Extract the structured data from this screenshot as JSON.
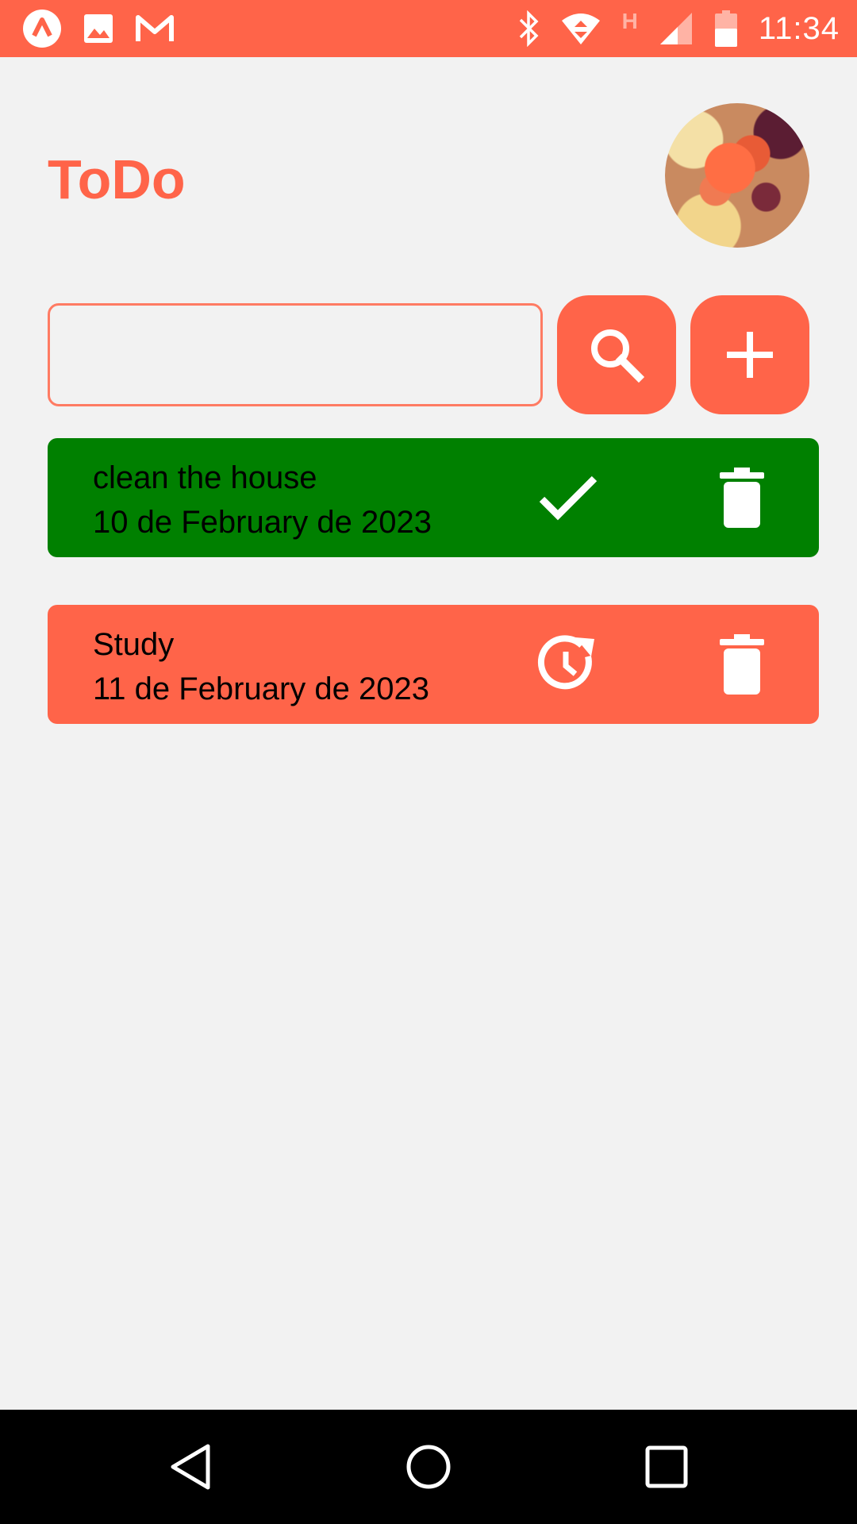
{
  "status_bar": {
    "time": "11:34",
    "left_icons": [
      "app-a-icon",
      "image-icon",
      "gmail-icon"
    ],
    "right_icons": [
      "bluetooth-icon",
      "wifi-icon",
      "h-network-icon",
      "signal-icon",
      "battery-icon"
    ],
    "network_label": "H"
  },
  "header": {
    "title": "ToDo"
  },
  "search": {
    "value": "",
    "search_icon": "search-icon",
    "add_icon": "plus-icon"
  },
  "tasks": [
    {
      "title": "clean the house",
      "date": "10 de February de 2023",
      "status": "done",
      "action_icon": "check-icon",
      "delete_icon": "trash-icon",
      "color": "#008000"
    },
    {
      "title": "Study",
      "date": "11 de February de 2023",
      "status": "pending",
      "action_icon": "clock-refresh-icon",
      "delete_icon": "trash-icon",
      "color": "#ff6449"
    }
  ],
  "colors": {
    "accent": "#ff6449",
    "done": "#008000",
    "background": "#f2f2f2"
  },
  "nav_bar": [
    "back-icon",
    "home-icon",
    "recents-icon"
  ]
}
